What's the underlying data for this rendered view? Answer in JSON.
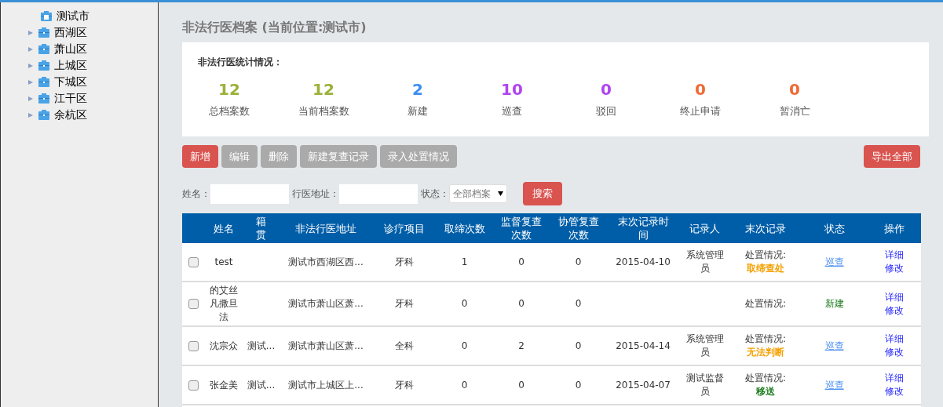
{
  "sidebar": {
    "tree": [
      {
        "label": "测试市",
        "children": [
          {
            "label": "西湖区",
            "expanded": false
          },
          {
            "label": "萧山区",
            "expanded": false
          },
          {
            "label": "上城区",
            "expanded": false
          },
          {
            "label": "下城区",
            "expanded": false
          },
          {
            "label": "江干区",
            "expanded": false
          },
          {
            "label": "余杭区",
            "expanded": false
          }
        ]
      }
    ]
  },
  "page_title": "非法行医档案 (当前位置:测试市)",
  "stats": {
    "title": "非法行医统计情况：",
    "items": [
      {
        "value": "12",
        "label": "总档案数",
        "color": "#9cb13a"
      },
      {
        "value": "12",
        "label": "当前档案数",
        "color": "#9cb13a"
      },
      {
        "value": "2",
        "label": "新建",
        "color": "#3d8ef0"
      },
      {
        "value": "10",
        "label": "巡查",
        "color": "#b045f0"
      },
      {
        "value": "0",
        "label": "驳回",
        "color": "#b045f0"
      },
      {
        "value": "0",
        "label": "终止申请",
        "color": "#f06a35"
      },
      {
        "value": "0",
        "label": "暂消亡",
        "color": "#f06a35"
      }
    ]
  },
  "toolbar": {
    "buttons": [
      {
        "label": "新增",
        "disabled": false
      },
      {
        "label": "编辑",
        "disabled": true
      },
      {
        "label": "删除",
        "disabled": true
      },
      {
        "label": "新建复查记录",
        "disabled": true
      },
      {
        "label": "录入处置情况",
        "disabled": true
      }
    ],
    "export": "导出全部"
  },
  "search": {
    "name_label": "姓名：",
    "address_label": "行医地址：",
    "status_label": "状态：",
    "status_value": "全部档案",
    "button": "搜索"
  },
  "table": {
    "columns": [
      "姓名",
      "籍贯",
      "非法行医地址",
      "诊疗项目",
      "取缔次数",
      "监督复查次数",
      "协管复查次数",
      "末次记录时间",
      "记录人",
      "末次记录",
      "状态",
      "操作"
    ],
    "rows": [
      {
        "checked": false,
        "name": "test",
        "origin": "",
        "address": "测试市西湖区西...",
        "item": "牙科",
        "bans": "1",
        "supervise": "0",
        "assist": "0",
        "last_time": "2015-04-10",
        "recorder": "系统管理员",
        "last_record": "处置情况:",
        "result": {
          "text": "取缔查处",
          "color": "#f5a000"
        },
        "status": {
          "text": "巡查",
          "kind": "link"
        },
        "actions": [
          "详细",
          "修改"
        ]
      },
      {
        "checked": false,
        "name": "的艾丝凡撒旦法",
        "origin": "",
        "address": "测试市萧山区萧...",
        "item": "牙科",
        "bans": "0",
        "supervise": "0",
        "assist": "0",
        "last_time": "",
        "recorder": "",
        "last_record": "处置情况:",
        "status": {
          "text": "新建",
          "kind": "text"
        },
        "actions": [
          "详细",
          "修改"
        ]
      },
      {
        "checked": false,
        "name": "沈宗众",
        "origin": "测试...",
        "address": "测试市萧山区萧...",
        "item": "全科",
        "bans": "0",
        "supervise": "2",
        "assist": "0",
        "last_time": "2015-04-14",
        "recorder": "系统管理员",
        "last_record": "处置情况:",
        "result": {
          "text": "无法判断",
          "color": "#f5a000"
        },
        "status": {
          "text": "巡查",
          "kind": "link"
        },
        "actions": [
          "详细",
          "修改"
        ]
      },
      {
        "checked": false,
        "name": "张金美",
        "origin": "测试...",
        "address": "测试市上城区上...",
        "item": "牙科",
        "bans": "0",
        "supervise": "0",
        "assist": "0",
        "last_time": "2015-04-07",
        "recorder": "测试监督员",
        "last_record": "处置情况:",
        "result": {
          "text": "移送",
          "color": "#1a7a1a"
        },
        "status": {
          "text": "巡查",
          "kind": "link"
        },
        "actions": [
          "详细",
          "修改"
        ]
      }
    ]
  }
}
